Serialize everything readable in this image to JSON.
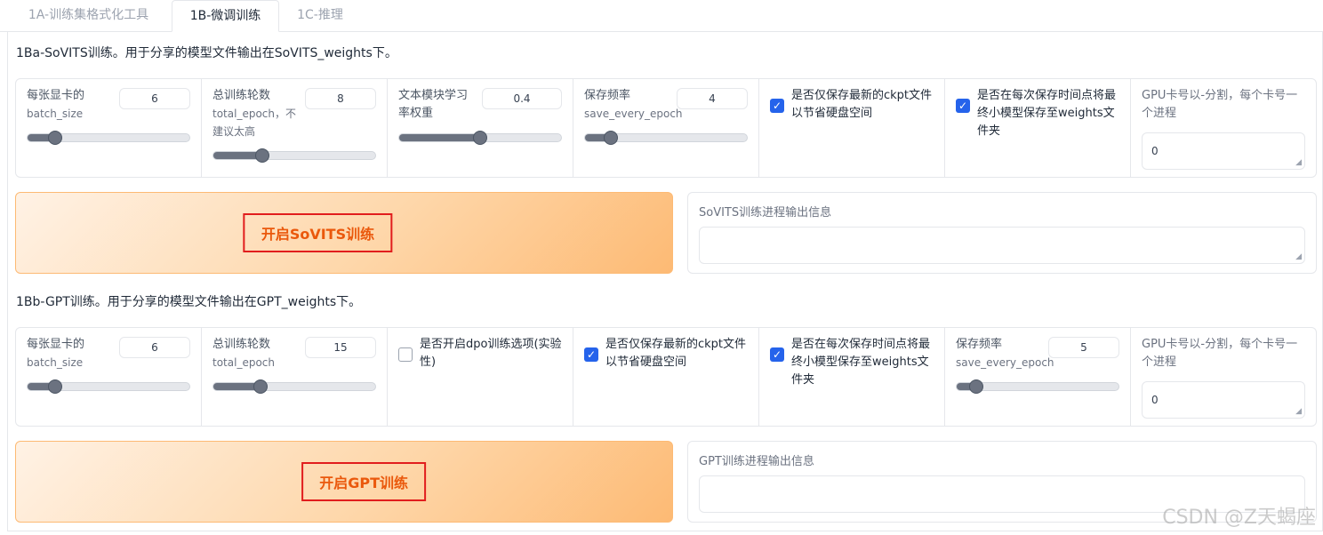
{
  "tabs": [
    {
      "label": "1A-训练集格式化工具"
    },
    {
      "label": "1B-微调训练"
    },
    {
      "label": "1C-推理"
    }
  ],
  "sovits": {
    "title": "1Ba-SoVITS训练。用于分享的模型文件输出在SoVITS_weights下。",
    "batch_size": {
      "label": "每张显卡的",
      "label_en": "batch_size",
      "value": "6",
      "slider_fraction": 0.17
    },
    "total_epoch": {
      "label": "总训练轮数",
      "label_en": "total_epoch，不建议太高",
      "value": "8",
      "slider_fraction": 0.3
    },
    "text_weight": {
      "label": "文本模块学习率权重",
      "value": "0.4",
      "slider_fraction": 0.5
    },
    "save_every": {
      "label": "保存频率",
      "label_en": "save_every_epoch",
      "value": "4",
      "slider_fraction": 0.16
    },
    "save_latest": {
      "label": "是否仅保存最新的ckpt文件以节省硬盘空间",
      "checked": true
    },
    "save_small": {
      "label": "是否在每次保存时间点将最终小模型保存至weights文件夹",
      "checked": true
    },
    "gpu": {
      "label": "GPU卡号以-分割，每个卡号一个进程",
      "value": "0"
    },
    "button": "开启SoVITS训练",
    "output_label": "SoVITS训练进程输出信息"
  },
  "gpt": {
    "title": "1Bb-GPT训练。用于分享的模型文件输出在GPT_weights下。",
    "batch_size": {
      "label": "每张显卡的",
      "label_en": "batch_size",
      "value": "6",
      "slider_fraction": 0.17
    },
    "total_epoch": {
      "label": "总训练轮数",
      "label_en": "total_epoch",
      "value": "15",
      "slider_fraction": 0.29
    },
    "dpo": {
      "label": "是否开启dpo训练选项(实验性)",
      "checked": false
    },
    "save_latest": {
      "label": "是否仅保存最新的ckpt文件以节省硬盘空间",
      "checked": true
    },
    "save_small": {
      "label": "是否在每次保存时间点将最终小模型保存至weights文件夹",
      "checked": true
    },
    "save_every": {
      "label": "保存频率",
      "label_en": "save_every_epoch",
      "value": "5",
      "slider_fraction": 0.12
    },
    "gpu": {
      "label": "GPU卡号以-分割，每个卡号一个进程",
      "value": "0"
    },
    "button": "开启GPT训练",
    "output_label": "GPT训练进程输出信息"
  },
  "watermark": "CSDN @Z天蝎座",
  "colors": {
    "accent": "#2563eb",
    "button_text": "#ea580c",
    "highlight_box": "#e11d1d"
  }
}
